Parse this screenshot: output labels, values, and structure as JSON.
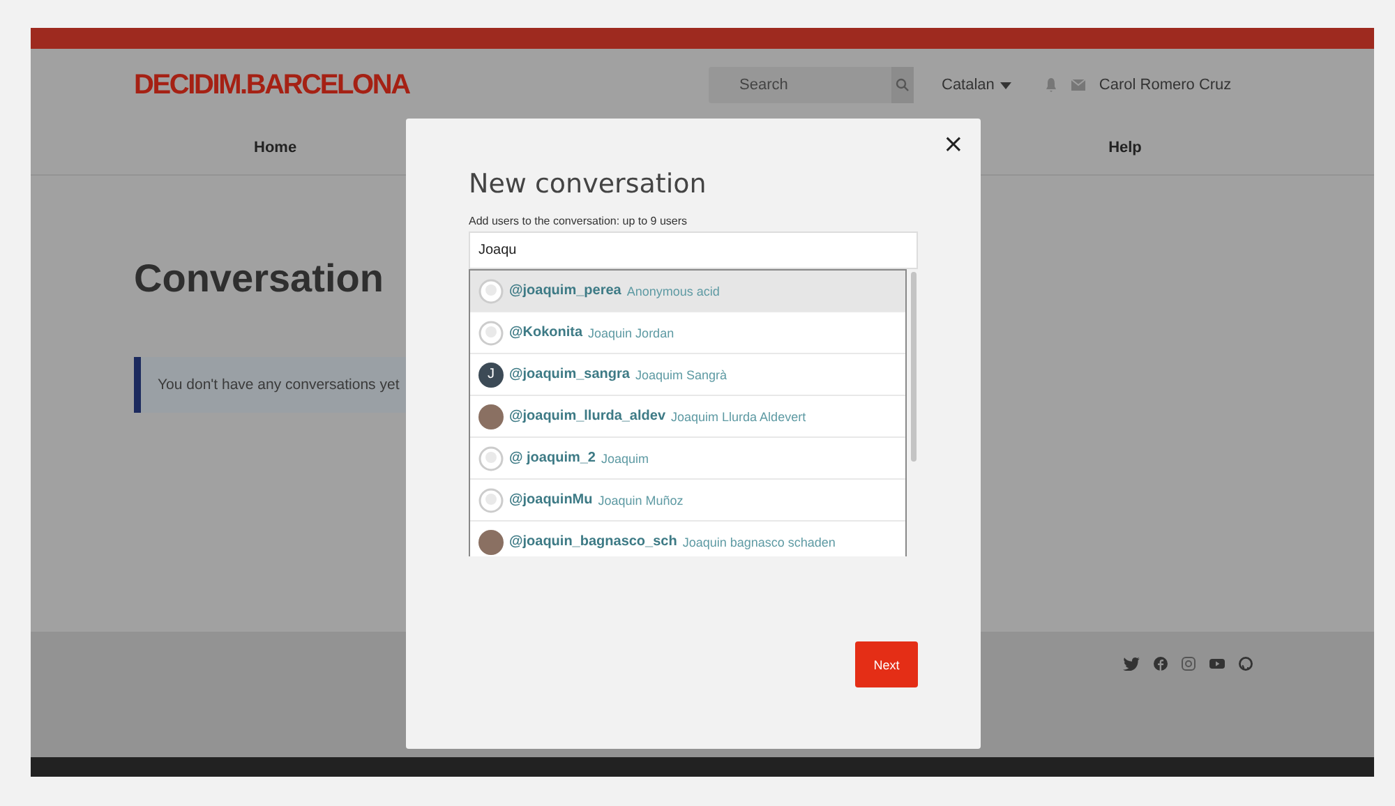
{
  "header": {
    "logo": "DECIDIM.BARCELONA",
    "search": {
      "placeholder": "Search"
    },
    "language": "Catalan",
    "user_name": "Carol Romero Cruz"
  },
  "nav": [
    {
      "label": "Home"
    },
    {
      "label": "Help"
    }
  ],
  "main": {
    "title": "Conversation",
    "notice": "You don't have any conversations yet"
  },
  "modal": {
    "close_label": "×",
    "title": "New conversation",
    "field_label": "Add users to the conversation: up to 9 users",
    "input_value": "Joaqu",
    "suggestions": [
      {
        "kind": "default",
        "handle": "@joaquim_perea",
        "name": "Anonymous acid",
        "selected": true
      },
      {
        "kind": "default",
        "handle": "@Kokonita",
        "name": "Joaquin Jordan",
        "selected": false
      },
      {
        "kind": "initial",
        "initial": "J",
        "handle": "@joaquim_sangra",
        "name": "Joaquim Sangrà",
        "selected": false
      },
      {
        "kind": "photo",
        "handle": "@joaquim_llurda_aldev",
        "name": "Joaquim Llurda Aldevert",
        "selected": false
      },
      {
        "kind": "default",
        "handle": "@ joaquim_2",
        "name": "Joaquim",
        "selected": false
      },
      {
        "kind": "default",
        "handle": "@joaquinMu",
        "name": "Joaquin Muñoz",
        "selected": false
      },
      {
        "kind": "photo",
        "handle": "@joaquin_bagnasco_sch",
        "name": "Joaquin bagnasco schaden",
        "selected": false
      }
    ],
    "next_button": "Next"
  }
}
